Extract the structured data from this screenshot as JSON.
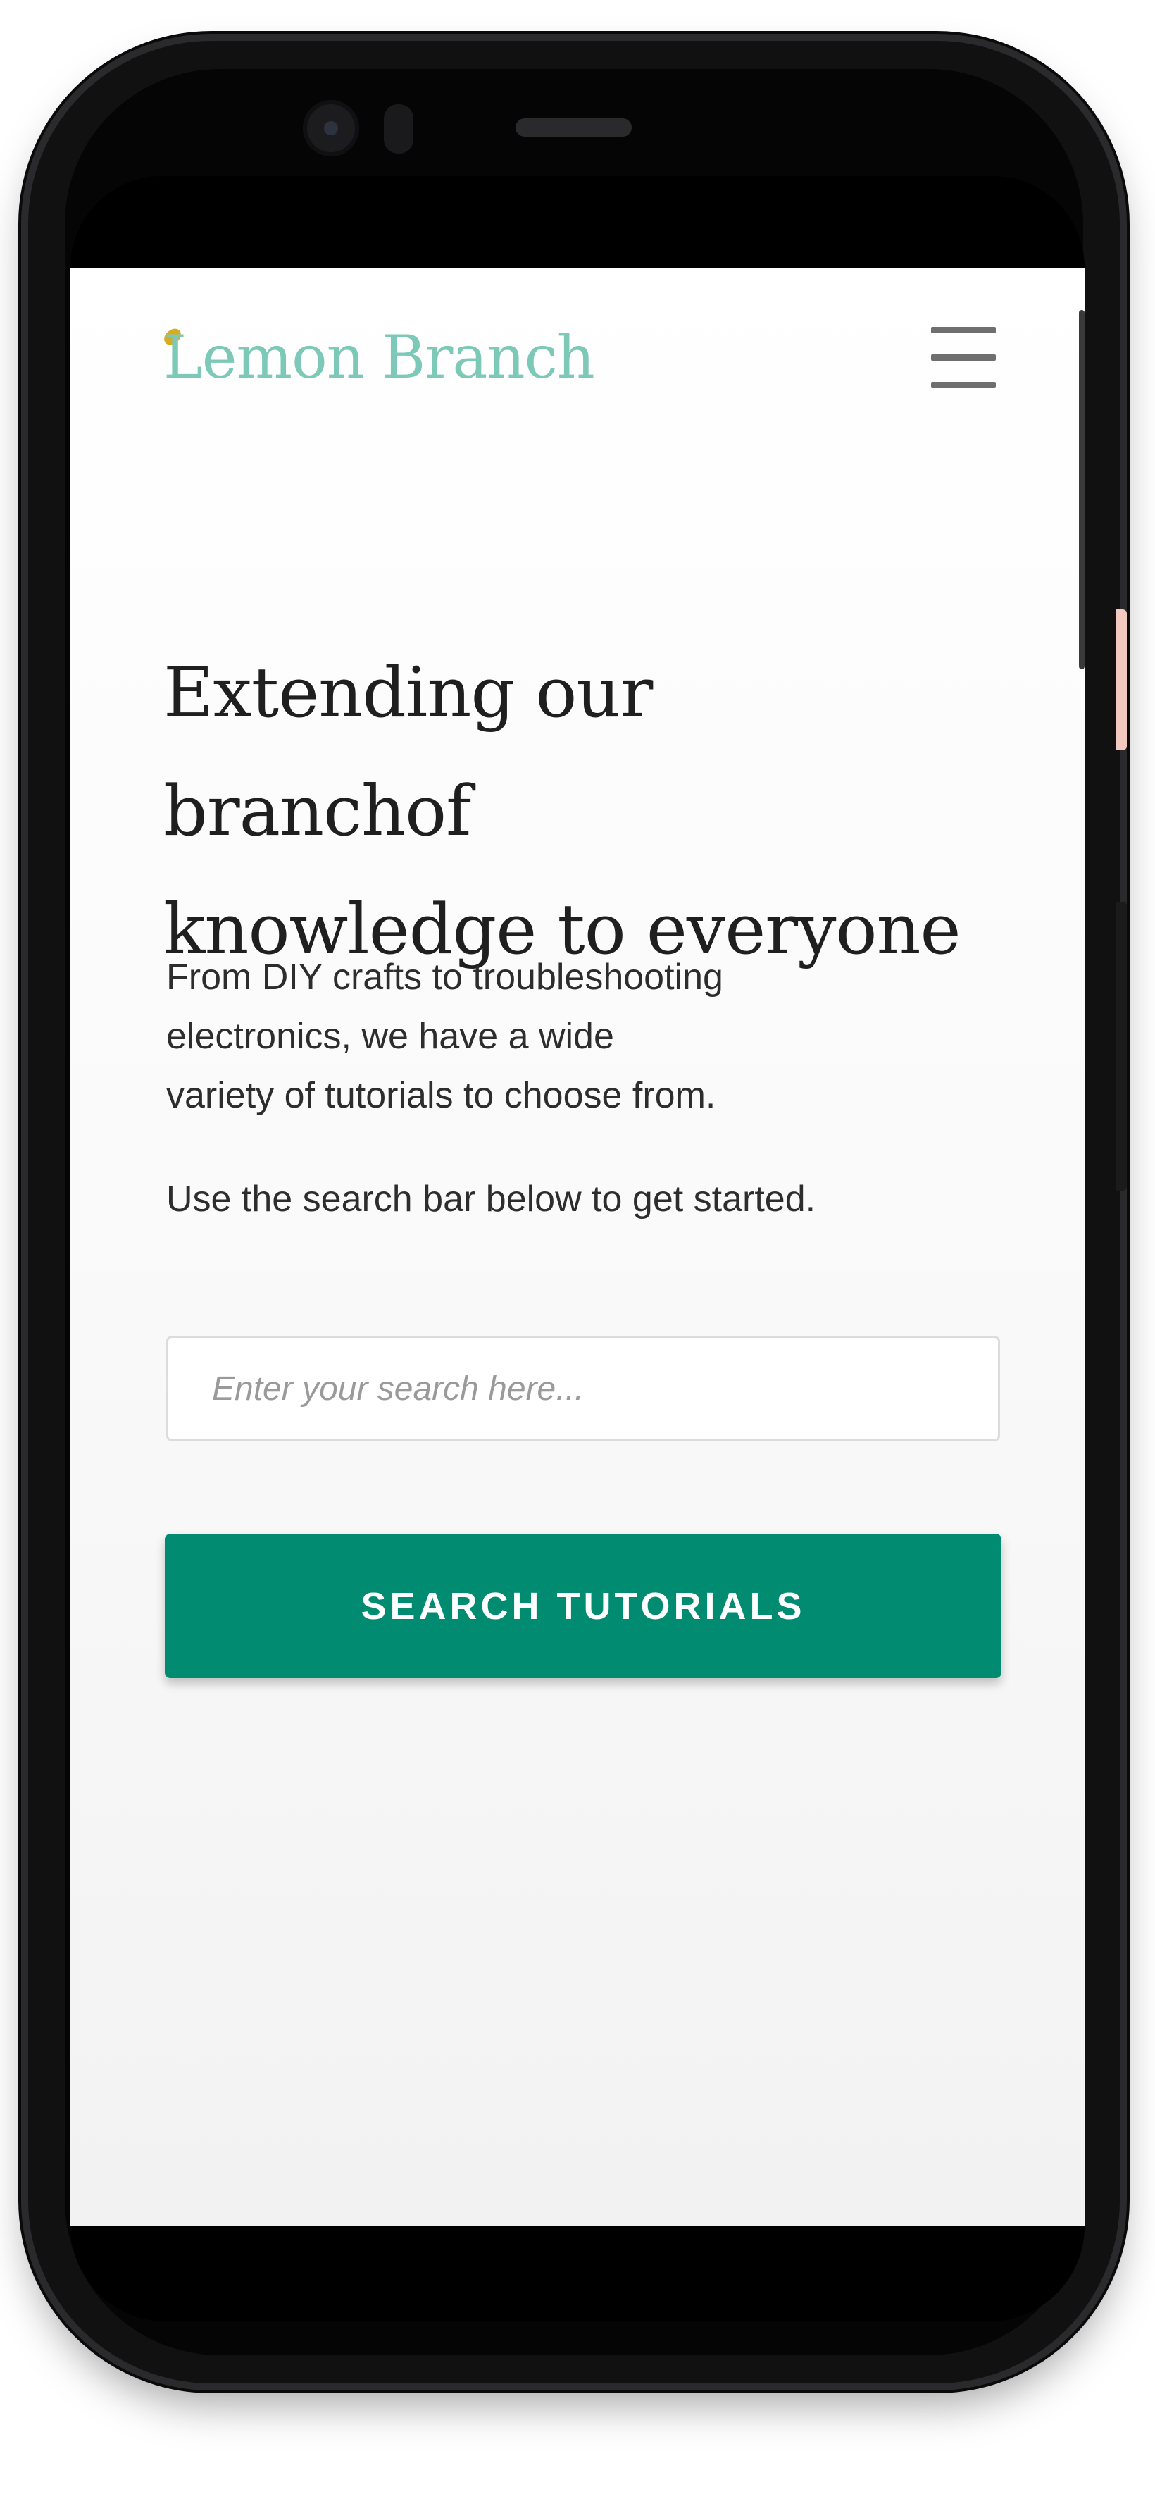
{
  "brand": {
    "name": "Lemon Branch",
    "leaf_color": "#d6ad22",
    "text_color": "#7dc9b8"
  },
  "header": {
    "menu_icon": "hamburger-menu-icon"
  },
  "hero": {
    "title_line1": "Extending our branchof",
    "title_line2": "knowledge to everyone",
    "intro_line1": "From DIY crafts to troubleshooting",
    "intro_line2": "electronics, we have a wide",
    "intro_line3": "variety of tutorials to choose from.",
    "instruction": "Use the search bar below to get started."
  },
  "search": {
    "placeholder": "Enter your search here...",
    "value": "",
    "button_label": "SEARCH TUTORIALS",
    "button_color": "#018b71"
  }
}
